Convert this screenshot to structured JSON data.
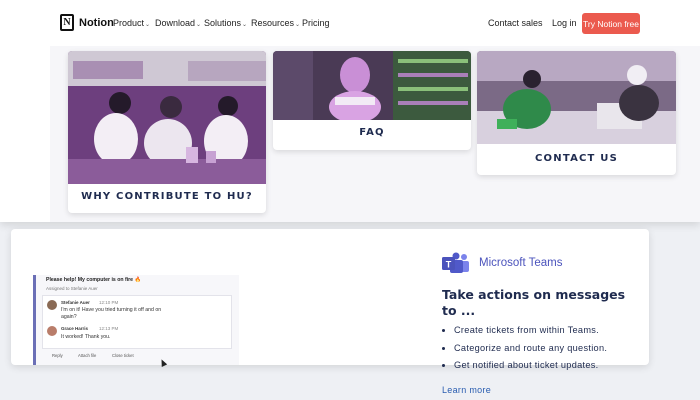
{
  "nav": {
    "logo_letter": "N",
    "brand": "Notion",
    "menu": [
      "Product",
      "Download",
      "Solutions",
      "Resources",
      "Pricing"
    ],
    "chevron": "⌄",
    "contact_sales": "Contact sales",
    "login": "Log in",
    "cta": "Try Notion free",
    "cta_color": "#eb5a4e"
  },
  "cards": {
    "why": "WHY CONTRIBUTE TO HU?",
    "faq": "FAQ",
    "contact": "CONTACT US"
  },
  "teams": {
    "product": "Microsoft Teams",
    "headline": "Take actions on messages to ...",
    "bullets": [
      "Create tickets from within Teams.",
      "Categorize and route any question.",
      "Get notified about ticket updates."
    ],
    "learn_more": "Learn more",
    "brand_color": "#4b53bc",
    "chat": {
      "title": "Please help! My computer is on fire 🔥",
      "assigned": "Assigned to Stefanie Auer",
      "messages": [
        {
          "name": "Stefanie Auer",
          "time": "12:10 PM",
          "text": "I'm on it! Have you tried turning it off and on again?"
        },
        {
          "name": "Grace Harris",
          "time": "12:13 PM",
          "text": "It worked! Thank you."
        }
      ],
      "actions": [
        "Reply",
        "Attach file",
        "Close ticket"
      ]
    }
  }
}
